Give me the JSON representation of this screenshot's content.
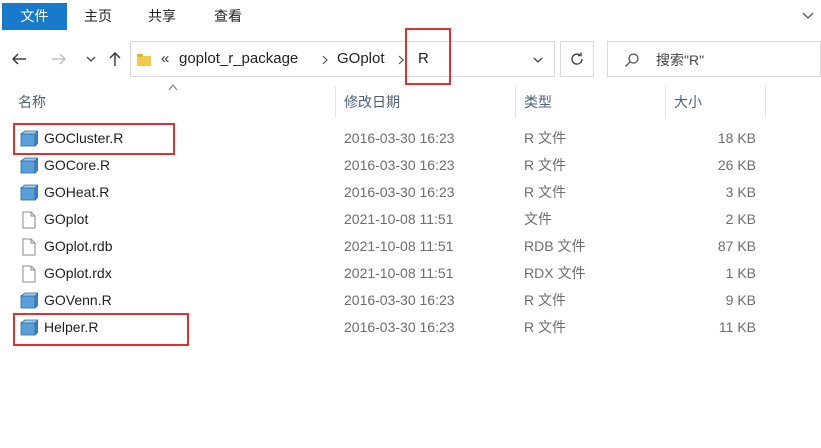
{
  "ribbon": {
    "tabs": [
      {
        "label": "文件"
      },
      {
        "label": "主页"
      },
      {
        "label": "共享"
      },
      {
        "label": "查看"
      }
    ]
  },
  "address": {
    "more_glyph": "«",
    "crumbs": [
      "goplot_r_package",
      "GOplot",
      "R"
    ]
  },
  "search": {
    "placeholder": "搜索\"R\""
  },
  "columns": {
    "name": "名称",
    "date": "修改日期",
    "type": "类型",
    "size": "大小"
  },
  "files": [
    {
      "name": "GOCluster.R",
      "date": "2016-03-30 16:23",
      "type": "R 文件",
      "size": "18 KB",
      "icon": "r-script-icon"
    },
    {
      "name": "GOCore.R",
      "date": "2016-03-30 16:23",
      "type": "R 文件",
      "size": "26 KB",
      "icon": "r-script-icon"
    },
    {
      "name": "GOHeat.R",
      "date": "2016-03-30 16:23",
      "type": "R 文件",
      "size": "3 KB",
      "icon": "r-script-icon"
    },
    {
      "name": "GOplot",
      "date": "2021-10-08 11:51",
      "type": "文件",
      "size": "2 KB",
      "icon": "blank-file-icon"
    },
    {
      "name": "GOplot.rdb",
      "date": "2021-10-08 11:51",
      "type": "RDB 文件",
      "size": "87 KB",
      "icon": "blank-file-icon"
    },
    {
      "name": "GOplot.rdx",
      "date": "2021-10-08 11:51",
      "type": "RDX 文件",
      "size": "1 KB",
      "icon": "blank-file-icon"
    },
    {
      "name": "GOVenn.R",
      "date": "2016-03-30 16:23",
      "type": "R 文件",
      "size": "9 KB",
      "icon": "r-script-icon"
    },
    {
      "name": "Helper.R",
      "date": "2016-03-30 16:23",
      "type": "R 文件",
      "size": "11 KB",
      "icon": "r-script-icon"
    }
  ],
  "colors": {
    "accent": "#1979ca",
    "highlight": "#e03030",
    "header_text": "#4c607a",
    "meta_text": "#6d6d6d"
  }
}
